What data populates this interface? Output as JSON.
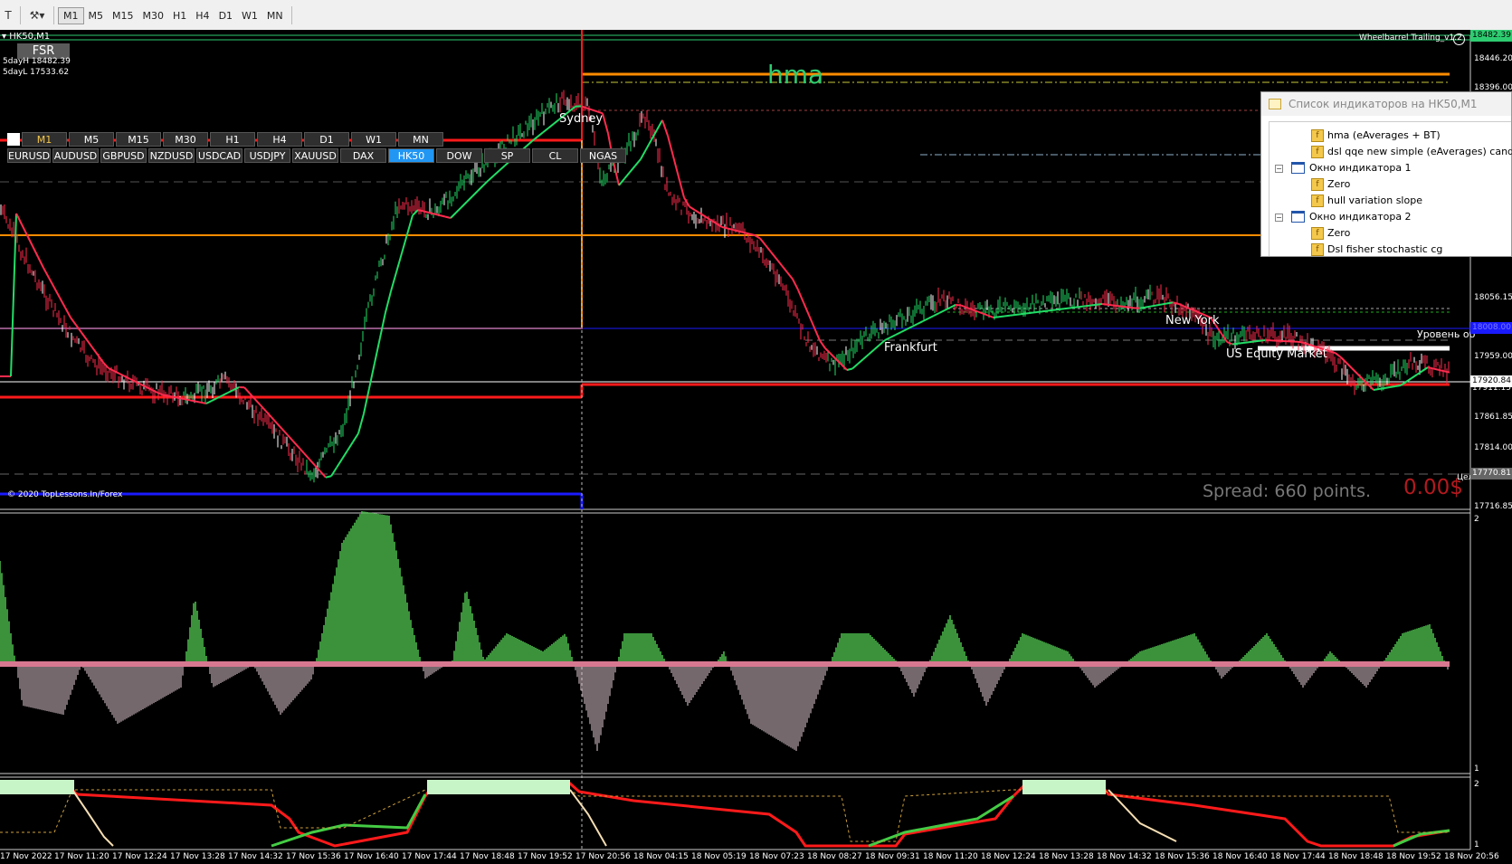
{
  "toolbar": {
    "icons": [
      "text-tool-icon",
      "objects-tool-icon"
    ],
    "timeframes": [
      "M1",
      "M5",
      "M15",
      "M30",
      "H1",
      "H4",
      "D1",
      "W1",
      "MN"
    ],
    "active_timeframe": "M1"
  },
  "chart": {
    "symbol_label": "HK50,M1",
    "fsr_label": "FSR",
    "stats": [
      "5dayH 18482.39",
      "5dayL 17533.62"
    ],
    "ea_label": "Wheelbarrel Trailing_v1.2",
    "hma_label": "hma",
    "copyright": "© 2020 TopLessons.In/Forex",
    "spread": "Spread: 660 points.",
    "profit": "0.00$",
    "session_labels": [
      "Sydney",
      "Frankfurt",
      "New York",
      "US Equity Market"
    ],
    "level_label": "Уровень об",
    "right_edge_label": "Цел",
    "timeframe_buttons": [
      "M1",
      "M5",
      "M15",
      "M30",
      "H1",
      "H4",
      "D1",
      "W1",
      "MN"
    ],
    "current_timeframe": "M1",
    "symbol_buttons": [
      "EURUSD",
      "AUDUSD",
      "GBPUSD",
      "NZDUSD",
      "USDCAD",
      "USDJPY",
      "XAUUSD",
      "DAX",
      "HK50",
      "DOW",
      "SP",
      "CL",
      "NGAS"
    ],
    "current_symbol": "HK50",
    "price_axis": [
      "18446.20",
      "18396.00",
      "18056.15",
      "17959.00",
      "17861.85",
      "17814.00",
      "17716.85"
    ],
    "price_tags": {
      "top": "18482.39",
      "blue": "18008.00",
      "white": "17920.84",
      "red": "17911.15",
      "gray": "17770.81"
    },
    "indicator1_axis": [
      "2",
      "1"
    ],
    "indicator2_axis": [
      "2",
      "1"
    ],
    "time_axis": [
      "17 Nov 2022",
      "17 Nov 11:20",
      "17 Nov 12:24",
      "17 Nov 13:28",
      "17 Nov 14:32",
      "17 Nov 15:36",
      "17 Nov 16:40",
      "17 Nov 17:44",
      "17 Nov 18:48",
      "17 Nov 19:52",
      "17 Nov 20:56",
      "18 Nov 04:15",
      "18 Nov 05:19",
      "18 Nov 07:23",
      "18 Nov 08:27",
      "18 Nov 09:31",
      "18 Nov 11:20",
      "18 Nov 12:24",
      "18 Nov 13:28",
      "18 Nov 14:32",
      "18 Nov 15:36",
      "18 Nov 16:40",
      "18 Nov 17:44",
      "18 Nov 18:48",
      "18 Nov 19:52",
      "18 Nov 20:56"
    ]
  },
  "indicator_list": {
    "title": "Список индикаторов на HK50,M1",
    "items": [
      "hma (eAverages + BT)",
      "dsl qqe new simple (eAverages) candles",
      "Окно индикатора 1",
      "Zero",
      "hull variation slope",
      "Окно индикатора 2",
      "Zero",
      "Dsl fisher stochastic cg"
    ]
  },
  "colors": {
    "bull": "#22dd66",
    "bear": "#ff2b4d",
    "orange": "#ff8c00",
    "red": "#ff1a1a",
    "blue": "#1a1aff",
    "hist_green": "#4fc24f",
    "hist_pink": "#d87890"
  }
}
